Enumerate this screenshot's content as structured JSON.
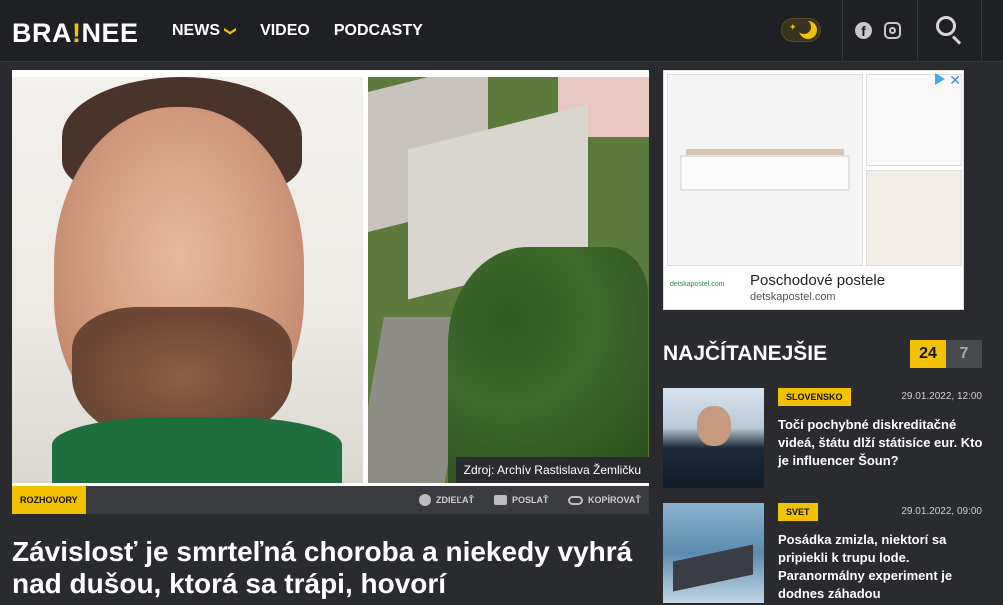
{
  "header": {
    "logo_left": "BRA",
    "logo_bang": "!",
    "logo_right": "NEE",
    "nav": [
      {
        "label": "NEWS"
      },
      {
        "label": "VIDEO"
      },
      {
        "label": "PODCASTY"
      }
    ],
    "nav_chevron": "❯"
  },
  "hero": {
    "credit": "Zdroj: Archív Rastislava Žemličku"
  },
  "meta": {
    "tag": "ROZHOVORY",
    "share": {
      "share_label": "ZDIEĽAŤ",
      "send_label": "POSLAŤ",
      "copy_label": "KOPÍROVAŤ"
    }
  },
  "article": {
    "headline": "Závislosť je smrteľná choroba a niekedy vyhrá nad dušou, ktorá sa trápi, hovorí"
  },
  "ad": {
    "brand": "detskapostel.com",
    "title": "Poschodové postele",
    "domain": "detskapostel.com",
    "close": "✕"
  },
  "sidebar": {
    "heading": "NAJČÍTANEJŠIE",
    "tabs": [
      {
        "label": "24"
      },
      {
        "label": "7"
      }
    ],
    "stories": [
      {
        "category": "SLOVENSKO",
        "date": "29.01.2022, 12:00",
        "title": "Točí pochybné diskreditačné videá, štátu dlží státisíce eur. Kto je influencer Šoun?"
      },
      {
        "category": "SVET",
        "date": "29.01.2022, 09:00",
        "title": "Posádka zmizla, niektorí sa pripiekli k trupu lode. Paranormálny experiment je dodnes záhadou"
      }
    ]
  },
  "colors": {
    "accent": "#f2c200",
    "background": "#2a2b2f",
    "header": "#1f2023"
  }
}
